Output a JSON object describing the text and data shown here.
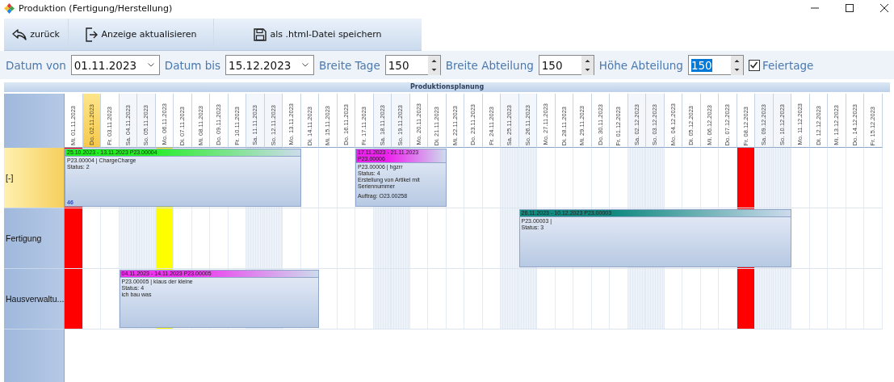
{
  "window": {
    "title": "Produktion (Fertigung/Herstellung)"
  },
  "toolbar": [
    {
      "label": "zurück",
      "kind": "back"
    },
    {
      "label": "Anzeige aktualisieren",
      "kind": "refresh"
    },
    {
      "label": "als .html-Datei speichern",
      "kind": "save"
    }
  ],
  "filters": [
    {
      "label": "Datum von",
      "kind": "date",
      "value": "01.11.2023"
    },
    {
      "label": "Datum bis",
      "kind": "date",
      "value": "15.12.2023"
    },
    {
      "label": "Breite Tage",
      "kind": "spin",
      "value": "150"
    },
    {
      "label": "Breite Abteilung",
      "kind": "spin",
      "value": "150"
    },
    {
      "label": "Höhe Abteilung",
      "kind": "spin",
      "value": "150",
      "focused": true
    }
  ],
  "holidays_checkbox": {
    "label": "Feiertage",
    "checked": true
  },
  "planning": {
    "title": "Produktionsplanung",
    "columns": [
      {
        "label": "Mi. 01.11.2023",
        "weekend": false,
        "today": false,
        "color": "#ff0000"
      },
      {
        "label": "Do. 02.11.2023",
        "weekend": false,
        "today": true
      },
      {
        "label": "Fr. 03.11.2023",
        "weekend": false,
        "today": false
      },
      {
        "label": "Sa. 04.11.2023",
        "weekend": true,
        "today": false
      },
      {
        "label": "So. 05.11.2023",
        "weekend": true,
        "today": false
      },
      {
        "label": "Mo. 06.11.2023",
        "weekend": false,
        "today": false,
        "color": "#ffff00"
      },
      {
        "label": "Di. 07.11.2023",
        "weekend": false,
        "today": false
      },
      {
        "label": "Mi. 08.11.2023",
        "weekend": false,
        "today": false
      },
      {
        "label": "Do. 09.11.2023",
        "weekend": false,
        "today": false
      },
      {
        "label": "Fr. 10.11.2023",
        "weekend": false,
        "today": false
      },
      {
        "label": "Sa. 11.11.2023",
        "weekend": true,
        "today": false
      },
      {
        "label": "So. 12.11.2023",
        "weekend": true,
        "today": false
      },
      {
        "label": "Mo. 13.11.2023",
        "weekend": false,
        "today": false
      },
      {
        "label": "Di. 14.11.2023",
        "weekend": false,
        "today": false
      },
      {
        "label": "Mi. 15.11.2023",
        "weekend": false,
        "today": false
      },
      {
        "label": "Do. 16.11.2023",
        "weekend": false,
        "today": false
      },
      {
        "label": "Fr. 17.11.2023",
        "weekend": false,
        "today": false
      },
      {
        "label": "Sa. 18.11.2023",
        "weekend": true,
        "today": false
      },
      {
        "label": "So. 19.11.2023",
        "weekend": true,
        "today": false
      },
      {
        "label": "Mo. 20.11.2023",
        "weekend": false,
        "today": false
      },
      {
        "label": "Di. 21.11.2023",
        "weekend": false,
        "today": false
      },
      {
        "label": "Mi. 22.11.2023",
        "weekend": false,
        "today": false
      },
      {
        "label": "Do. 23.11.2023",
        "weekend": false,
        "today": false
      },
      {
        "label": "Fr. 24.11.2023",
        "weekend": false,
        "today": false
      },
      {
        "label": "Sa. 25.11.2023",
        "weekend": true,
        "today": false
      },
      {
        "label": "So. 26.11.2023",
        "weekend": true,
        "today": false
      },
      {
        "label": "Mo. 27.11.2023",
        "weekend": false,
        "today": false
      },
      {
        "label": "Di. 28.11.2023",
        "weekend": false,
        "today": false
      },
      {
        "label": "Mi. 29.11.2023",
        "weekend": false,
        "today": false
      },
      {
        "label": "Do. 30.11.2023",
        "weekend": false,
        "today": false
      },
      {
        "label": "Fr. 01.12.2023",
        "weekend": false,
        "today": false
      },
      {
        "label": "Sa. 02.12.2023",
        "weekend": true,
        "today": false
      },
      {
        "label": "So. 03.12.2023",
        "weekend": true,
        "today": false
      },
      {
        "label": "Mo. 04.12.2023",
        "weekend": false,
        "today": false
      },
      {
        "label": "Di. 05.12.2023",
        "weekend": false,
        "today": false
      },
      {
        "label": "Mi. 06.12.2023",
        "weekend": false,
        "today": false
      },
      {
        "label": "Do. 07.12.2023",
        "weekend": false,
        "today": false
      },
      {
        "label": "Fr. 08.12.2023",
        "weekend": false,
        "today": false,
        "color": "#ff0000"
      },
      {
        "label": "Sa. 09.12.2023",
        "weekend": true,
        "today": false
      },
      {
        "label": "So. 10.12.2023",
        "weekend": true,
        "today": false
      },
      {
        "label": "Mo. 11.12.2023",
        "weekend": false,
        "today": false
      },
      {
        "label": "Di. 12.12.2023",
        "weekend": false,
        "today": false
      },
      {
        "label": "Mi. 13.12.2023",
        "weekend": false,
        "today": false
      },
      {
        "label": "Do. 14.12.2023",
        "weekend": false,
        "today": false
      },
      {
        "label": "Fr. 15.12.2023",
        "weekend": false,
        "today": false
      }
    ],
    "rows": [
      {
        "label": "[-]",
        "selected": true,
        "bars": [
          {
            "header": "25.10.2023 - 13.11.2023 P23.00004",
            "color": "#22ee22",
            "lines": [
              "P23.00004 | ChargeCharge",
              "Status: 2"
            ],
            "footer": "46"
          },
          {
            "header": "17.11.2023 - 21.11.2023 P23.00006",
            "color": "#ee22ee",
            "lines": [
              "P23.00006 | hgzrr",
              "Status: 4",
              "Erstellung von Artikel mit Seriennummer"
            ],
            "note": "Auftrag: O23.00258"
          }
        ]
      },
      {
        "label": "Fertigung",
        "selected": false,
        "bars": [
          {
            "header": "26.11.2023 - 10.12.2023 P23.00003",
            "color": "#128a80",
            "lines": [
              "P23.00003 |",
              "Status: 3"
            ]
          }
        ]
      },
      {
        "label": "Hausverwaltu...",
        "selected": false,
        "bars": [
          {
            "header": "04.11.2023 - 14.11.2023 P23.00005",
            "color": "#ee33ee",
            "lines": [
              "P23.00005 | klaus der kleine",
              "Status: 4",
              "ich bau was"
            ]
          }
        ]
      }
    ]
  }
}
